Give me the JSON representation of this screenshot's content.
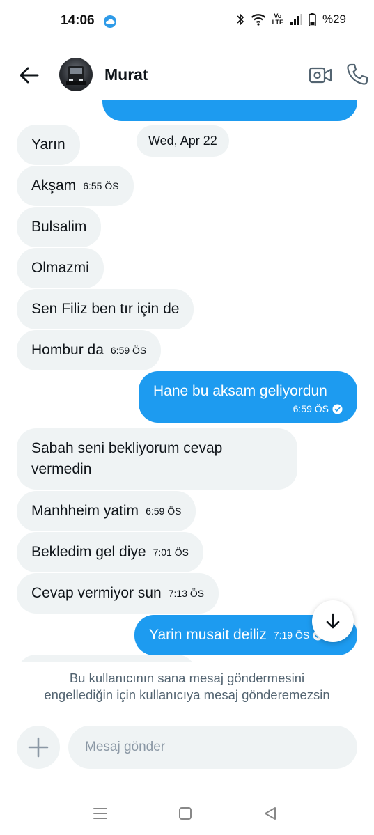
{
  "status_bar": {
    "time": "14:06",
    "network_label_top": "Vo",
    "network_label_bottom": "LTE",
    "battery": "%29"
  },
  "header": {
    "contact_name": "Murat"
  },
  "conversation": {
    "date_chip": "Wed, Apr 22",
    "messages": [
      {
        "direction": "received",
        "text": "Yarın",
        "time": ""
      },
      {
        "direction": "received",
        "text": "Akşam",
        "time": "6:55 ÖS"
      },
      {
        "direction": "received",
        "text": "Bulsalim",
        "time": ""
      },
      {
        "direction": "received",
        "text": "Olmazmi",
        "time": ""
      },
      {
        "direction": "received",
        "text": "Sen Filiz ben tır için de",
        "time": ""
      },
      {
        "direction": "received",
        "text": "Hombur da",
        "time": "6:59 ÖS"
      },
      {
        "direction": "sent",
        "text": "Hane bu aksam geliyordun",
        "time": "6:59 ÖS"
      },
      {
        "direction": "received",
        "text": "Sabah seni bekliyorum cevap vermedin",
        "time": ""
      },
      {
        "direction": "received",
        "text": "Manhheim yatim",
        "time": "6:59 ÖS"
      },
      {
        "direction": "received",
        "text": "Bekledim gel diye",
        "time": "7:01 ÖS"
      },
      {
        "direction": "received",
        "text": "Cevap vermiyor sun",
        "time": "7:13 ÖS"
      },
      {
        "direction": "sent",
        "text": "Yarin musait deiliz",
        "time": "7:19 ÖS"
      }
    ]
  },
  "blocked_notice": {
    "line1": "Bu kullanıcının sana mesaj göndermesini",
    "line2": "engellediğin için kullanıcıya mesaj gönderemezsin"
  },
  "composer": {
    "placeholder": "Mesaj gönder"
  },
  "icons": {
    "back": "arrow-left-icon",
    "video": "video-camera-icon",
    "call": "phone-icon",
    "add": "plus-icon",
    "scroll_down": "arrow-down-icon",
    "read_receipt": "check-circle-icon"
  },
  "colors": {
    "sent_bubble": "#1d9bf0",
    "received_bubble": "#eff3f4",
    "notice_text": "#536471"
  }
}
